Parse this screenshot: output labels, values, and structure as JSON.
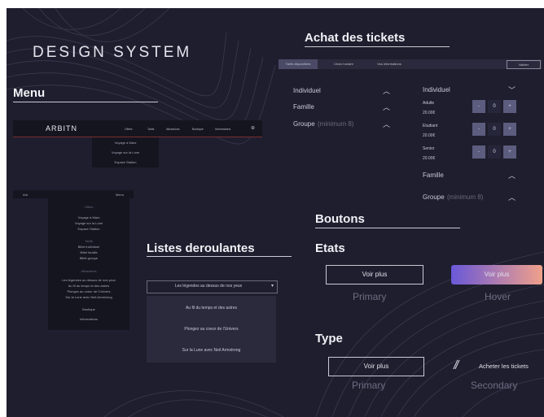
{
  "page_title": "DESIGN SYSTEM",
  "sections": {
    "menu": "Menu",
    "tickets": "Achat des tickets",
    "dropdowns": "Listes deroulantes",
    "buttons": "Boutons",
    "states": "Etats",
    "type": "Type"
  },
  "desktop_nav": {
    "logo": "ARBITN",
    "items": [
      "Offres",
      "Tarifs",
      "Attractions",
      "Boutique",
      "Informations"
    ],
    "cart_icon": "cart-icon",
    "submenu": [
      "Voyage à Mars",
      "Voyage sur la Lune",
      "Espace Station"
    ]
  },
  "mobile_nav": {
    "left": "Arb",
    "right": "Menu",
    "groups": [
      {
        "title": "Offres",
        "items": [
          "Voyage à Mars",
          "Voyage sur la Lune",
          "Espace Station"
        ]
      },
      {
        "title": "Tarifs",
        "items": [
          "Billet individuel",
          "Billet famille",
          "Billet groupe"
        ]
      },
      {
        "title": "Attractions",
        "items": [
          "Les légendes au dessus de nos yeux",
          "Au fil du temps et des astres",
          "Plongez au coeur de l'Univers",
          "Sur la Lune avec Neil Armstrong"
        ]
      },
      {
        "title": "Boutique",
        "items": []
      },
      {
        "title": "Informations",
        "items": []
      }
    ]
  },
  "ticket_tabs": [
    "Tarifs disponibles",
    "Choix horaire",
    "Vos informations"
  ],
  "ticket_tab_right": "Valider",
  "ticket_left": [
    {
      "label": "Individuel",
      "note": ""
    },
    {
      "label": "Famille",
      "note": ""
    },
    {
      "label": "Groupe",
      "note": "(minimum 8)"
    }
  ],
  "ticket_right": {
    "header": "Individuel",
    "rows": [
      {
        "name": "Adulte",
        "price": "20.00€",
        "minus": "-",
        "qty": "0",
        "plus": "+"
      },
      {
        "name": "Etudiant",
        "price": "20.00€",
        "minus": "-",
        "qty": "0",
        "plus": "+"
      },
      {
        "name": "Senior",
        "price": "20.00€",
        "minus": "-",
        "qty": "0",
        "plus": "+"
      }
    ],
    "famille": "Famille",
    "groupe": "Groupe",
    "groupe_note": "(minimum 8)"
  },
  "dropdown": {
    "selected": "Les légendes au dessus de nos yeux",
    "options": [
      "Au fil du temps et des astres",
      "Plongez au coeur de l'Univers",
      "Sur la Lune avec Neil Armstrong"
    ]
  },
  "buttons": {
    "states": {
      "primary_label": "Voir plus",
      "primary_caption": "Primary",
      "hover_label": "Voir plus",
      "hover_caption": "Hover"
    },
    "type": {
      "primary_label": "Voir plus",
      "primary_caption": "Primary",
      "secondary_label": "Acheter les tickets",
      "secondary_caption": "Secondary"
    }
  },
  "colors": {
    "background": "#1e1e2e",
    "accent_gradient_start": "#6a58d8",
    "accent_gradient_end": "#f0a08a",
    "stepper": "#5c5c7e"
  }
}
